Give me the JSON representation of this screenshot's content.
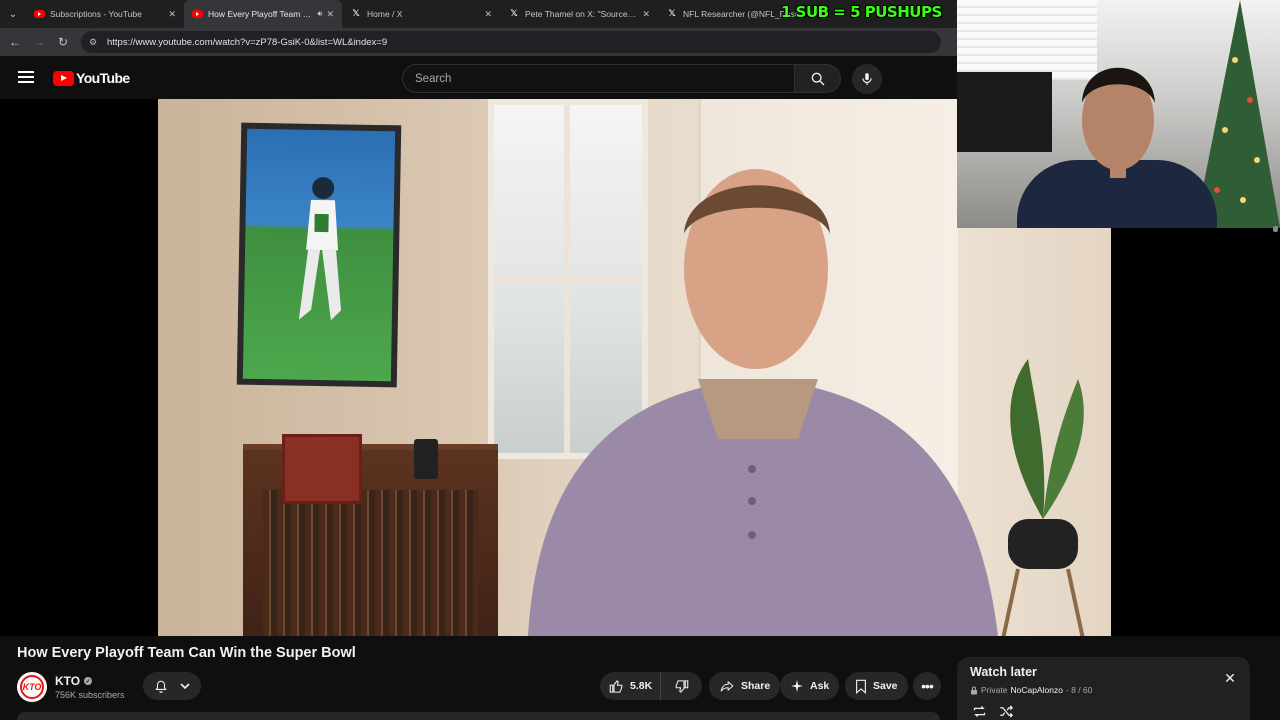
{
  "browser": {
    "tabs": [
      {
        "title": "Subscriptions - YouTube",
        "icon": "youtube-icon",
        "active": false
      },
      {
        "title": "How Every Playoff Team Ca",
        "icon": "youtube-icon",
        "active": true,
        "audio": true
      },
      {
        "title": "Home / X",
        "icon": "x-icon",
        "active": false
      },
      {
        "title": "Pete Thamel on X: \"Sources: Oh",
        "icon": "x-icon",
        "active": false
      },
      {
        "title": "NFL Researcher (@NFL_Rese",
        "icon": "x-icon",
        "active": false
      }
    ],
    "url": "https://www.youtube.com/watch?v=zP78-GsiK-0&list=WL&index=9"
  },
  "overlay": {
    "banner": "1 SUB = 5 PUSHUPS",
    "banner_color": "#39ff14"
  },
  "youtube": {
    "logo_text": "YouTube",
    "search": {
      "placeholder": "Search"
    },
    "video": {
      "title": "How Every Playoff Team Can Win the Super Bowl",
      "channel": "KTO",
      "channel_avatar_text": "KTO",
      "subscribers": "756K subscribers",
      "likes": "5.8K",
      "share_label": "Share",
      "ask_label": "Ask",
      "save_label": "Save"
    },
    "playlist": {
      "title": "Watch later",
      "privacy": "Private",
      "owner": "NoCapAlonzo",
      "position": "- 8 / 60"
    }
  },
  "colors": {
    "accent": "#ff0000",
    "background": "#0f0f0f",
    "button": "#272727"
  }
}
